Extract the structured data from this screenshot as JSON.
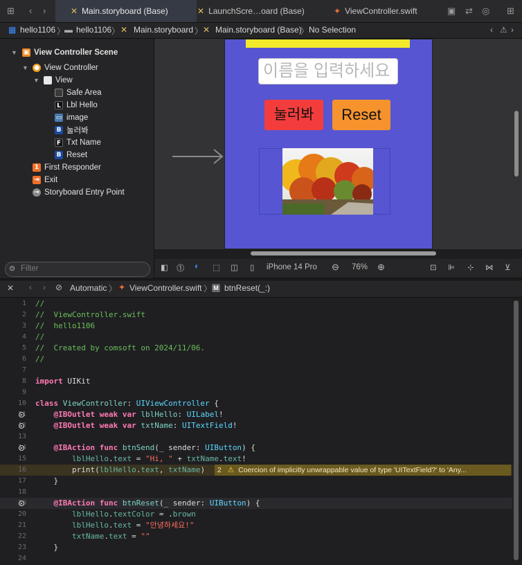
{
  "tabs": [
    {
      "label": "Main.storyboard (Base)",
      "icon": "storyboard-icon",
      "active": true
    },
    {
      "label": "LaunchScre…oard (Base)",
      "icon": "storyboard-icon",
      "active": false
    },
    {
      "label": "ViewController.swift",
      "icon": "swift-icon",
      "active": false
    }
  ],
  "breadcrumbs": [
    "hello1106",
    "hello1106",
    "Main.storyboard",
    "Main.storyboard (Base)",
    "No Selection"
  ],
  "navigator": {
    "items": [
      {
        "label": "View Controller Scene",
        "badge": "▣",
        "badge_color": "#f08a24"
      },
      {
        "label": "View Controller",
        "badge": "●",
        "badge_color": "#f0a020"
      },
      {
        "label": "View",
        "badge": "",
        "badge_color": "#e8e8e8"
      },
      {
        "label": "Safe Area",
        "badge": "",
        "badge_color": "#555555"
      },
      {
        "label": "Lbl Hello",
        "badge": "L",
        "badge_color": "#111111"
      },
      {
        "label": "image",
        "badge": "▭",
        "badge_color": "#4a7ab0"
      },
      {
        "label": "눌러봐",
        "badge": "B",
        "badge_color": "#1a4aa0"
      },
      {
        "label": "Txt Name",
        "badge": "F",
        "badge_color": "#111111"
      },
      {
        "label": "Reset",
        "badge": "B",
        "badge_color": "#1a4aa0"
      },
      {
        "label": "First Responder",
        "badge": "1",
        "badge_color": "#f0702a"
      },
      {
        "label": "Exit",
        "badge": "⇥",
        "badge_color": "#f0702a"
      },
      {
        "label": "Storyboard Entry Point",
        "badge": "→",
        "badge_color": "#8a8a8a"
      }
    ],
    "filter_placeholder": "Filter"
  },
  "storyboard": {
    "text_field_placeholder": "이름을 입력하세요",
    "send_button_label": "눌러봐",
    "reset_button_label": "Reset",
    "device_background": "#5755d1",
    "label_color": "#f2ea2a"
  },
  "canvas_toolbar": {
    "device": "iPhone 14 Pro",
    "zoom": "76%"
  },
  "editor_jumpbar": {
    "mode": "Automatic",
    "file": "ViewController.swift",
    "method": "btnReset(_:)"
  },
  "code_lines": [
    {
      "n": "1",
      "html": "<span class='cm'>//</span>"
    },
    {
      "n": "2",
      "html": "<span class='cm'>//  ViewController.swift</span>"
    },
    {
      "n": "3",
      "html": "<span class='cm'>//  hello1106</span>"
    },
    {
      "n": "4",
      "html": "<span class='cm'>//</span>"
    },
    {
      "n": "5",
      "html": "<span class='cm'>//  Created by comsoft on 2024/11/06.</span>"
    },
    {
      "n": "6",
      "html": "<span class='cm'>//</span>"
    },
    {
      "n": "7",
      "html": ""
    },
    {
      "n": "8",
      "html": "<span class='kw'>import</span> UIKit"
    },
    {
      "n": "9",
      "html": ""
    },
    {
      "n": "10",
      "html": "<span class='kw'>class</span> <span class='tyd'>ViewController</span>: <span class='ty'>UIViewController</span> {"
    },
    {
      "n": "11",
      "html": "    <span class='kw'>@IBOutlet</span> <span class='kw'>weak</span> <span class='kw'>var</span> <span class='tyd'>lblHello</span>: <span class='ty'>UILabel</span>!",
      "outlet": true
    },
    {
      "n": "12",
      "html": "    <span class='kw'>@IBOutlet</span> <span class='kw'>weak</span> <span class='kw'>var</span> <span class='tyd'>txtName</span>: <span class='ty'>UITextField</span>!",
      "outlet": true
    },
    {
      "n": "13",
      "html": ""
    },
    {
      "n": "14",
      "html": "    <span class='kw'>@IBAction</span> <span class='kw'>func</span> <span class='tyd'>btnSend</span>(_ sender: <span class='ty'>UIButton</span>) {",
      "outlet": true
    },
    {
      "n": "15",
      "html": "        <span class='prop'>lblHello</span>.<span class='prop'>text</span> = <span class='str'>\"Hi, \"</span> + <span class='prop'>txtName</span>.<span class='prop'>text</span>!"
    },
    {
      "n": "16",
      "html": "        print(<span class='prop'>lblHello</span>.<span class='prop'>text</span>, <span class='prop'>txtName</span>)",
      "warning": true
    },
    {
      "n": "17",
      "html": "    }"
    },
    {
      "n": "18",
      "html": ""
    },
    {
      "n": "19",
      "html": "    <span class='kw'>@IBAction</span> <span class='kw'>func</span> <span class='tyd'>btnReset</span>(_ sender: <span class='ty'>UIButton</span>) {",
      "outlet": true,
      "current": true
    },
    {
      "n": "20",
      "html": "        <span class='prop'>lblHello</span>.<span class='prop'>textColor</span> = .<span class='prop'>brown</span>"
    },
    {
      "n": "21",
      "html": "        <span class='prop'>lblHello</span>.<span class='prop'>text</span> = <span class='str'>\"안녕하세요!\"</span>"
    },
    {
      "n": "22",
      "html": "        <span class='prop'>txtName</span>.<span class='prop'>text</span> = <span class='str'>\"\"</span>"
    },
    {
      "n": "23",
      "html": "    }"
    },
    {
      "n": "24",
      "html": ""
    }
  ],
  "warning": {
    "count": "2",
    "message": "Coercion of implicitly unwrappable value of type 'UITextField?' to 'Any..."
  }
}
